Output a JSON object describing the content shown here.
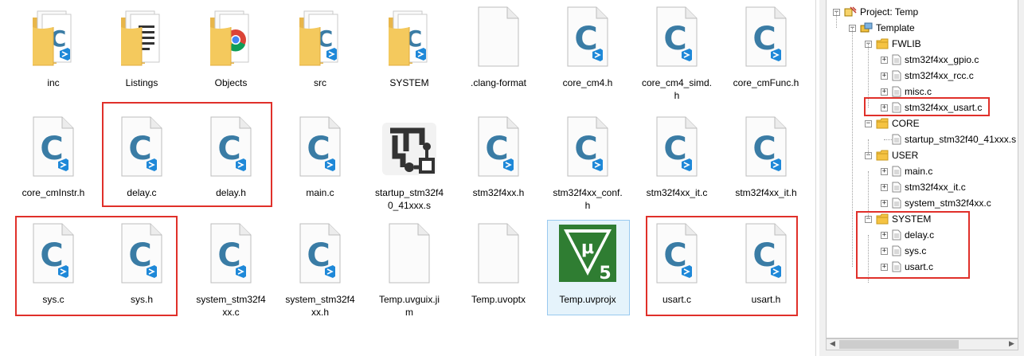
{
  "files": [
    {
      "name": "inc",
      "type": "folder-c"
    },
    {
      "name": "Listings",
      "type": "folder-doc"
    },
    {
      "name": "Objects",
      "type": "folder-chrome"
    },
    {
      "name": "src",
      "type": "folder-c"
    },
    {
      "name": "SYSTEM",
      "type": "folder-c"
    },
    {
      "name": ".clang-format",
      "type": "blank"
    },
    {
      "name": "core_cm4.h",
      "type": "c"
    },
    {
      "name": "core_cm4_simd.\nh",
      "type": "c"
    },
    {
      "name": "core_cmFunc.h",
      "type": "c"
    },
    {
      "name": "core_cmInstr.h",
      "type": "c"
    },
    {
      "name": "delay.c",
      "type": "c"
    },
    {
      "name": "delay.h",
      "type": "c"
    },
    {
      "name": "main.c",
      "type": "c"
    },
    {
      "name": "startup_stm32f4\n0_41xxx.s",
      "type": "asm"
    },
    {
      "name": "stm32f4xx.h",
      "type": "c"
    },
    {
      "name": "stm32f4xx_conf.\nh",
      "type": "c"
    },
    {
      "name": "stm32f4xx_it.c",
      "type": "c"
    },
    {
      "name": "stm32f4xx_it.h",
      "type": "c"
    },
    {
      "name": "sys.c",
      "type": "c"
    },
    {
      "name": "sys.h",
      "type": "c"
    },
    {
      "name": "system_stm32f4\nxx.c",
      "type": "c"
    },
    {
      "name": "system_stm32f4\nxx.h",
      "type": "c"
    },
    {
      "name": "Temp.uvguix.ji\nm",
      "type": "blank"
    },
    {
      "name": "Temp.uvoptx",
      "type": "blank"
    },
    {
      "name": "Temp.uvprojx",
      "type": "uvision"
    },
    {
      "name": "usart.c",
      "type": "c"
    },
    {
      "name": "usart.h",
      "type": "c"
    }
  ],
  "tree": [
    {
      "label": "Project: Temp",
      "level": 0,
      "icon": "project-icon",
      "expanded": true
    },
    {
      "label": "Template",
      "level": 1,
      "icon": "target-icon",
      "expanded": true
    },
    {
      "label": "FWLIB",
      "level": 2,
      "icon": "folder-icon",
      "expanded": true
    },
    {
      "label": "stm32f4xx_gpio.c",
      "level": 3,
      "icon": "file-icon",
      "expander": "+"
    },
    {
      "label": "stm32f4xx_rcc.c",
      "level": 3,
      "icon": "file-icon",
      "expander": "+"
    },
    {
      "label": "misc.c",
      "level": 3,
      "icon": "file-icon",
      "expander": "+"
    },
    {
      "label": "stm32f4xx_usart.c",
      "level": 3,
      "icon": "file-icon",
      "expander": "+"
    },
    {
      "label": "CORE",
      "level": 2,
      "icon": "folder-icon",
      "expanded": true
    },
    {
      "label": "startup_stm32f40_41xxx.s",
      "level": 3,
      "icon": "file-icon",
      "expander": ""
    },
    {
      "label": "USER",
      "level": 2,
      "icon": "folder-icon",
      "expanded": true
    },
    {
      "label": "main.c",
      "level": 3,
      "icon": "file-icon",
      "expander": "+"
    },
    {
      "label": "stm32f4xx_it.c",
      "level": 3,
      "icon": "file-icon",
      "expander": "+"
    },
    {
      "label": "system_stm32f4xx.c",
      "level": 3,
      "icon": "file-icon",
      "expander": "+"
    },
    {
      "label": "SYSTEM",
      "level": 2,
      "icon": "folder-icon",
      "expanded": true
    },
    {
      "label": "delay.c",
      "level": 3,
      "icon": "file-icon",
      "expander": "+"
    },
    {
      "label": "sys.c",
      "level": 3,
      "icon": "file-icon",
      "expander": "+"
    },
    {
      "label": "usart.c",
      "level": 3,
      "icon": "file-icon",
      "expander": "+"
    }
  ],
  "scrollbar": {
    "left_arrow": "◀",
    "right_arrow": "▶"
  },
  "colors": {
    "highlight": "#e0302a",
    "c_letter": "#3a7ca5",
    "vscode_badge": "#1e88d8",
    "folder": "#f4c95d",
    "uvision": "#2f7d32"
  }
}
